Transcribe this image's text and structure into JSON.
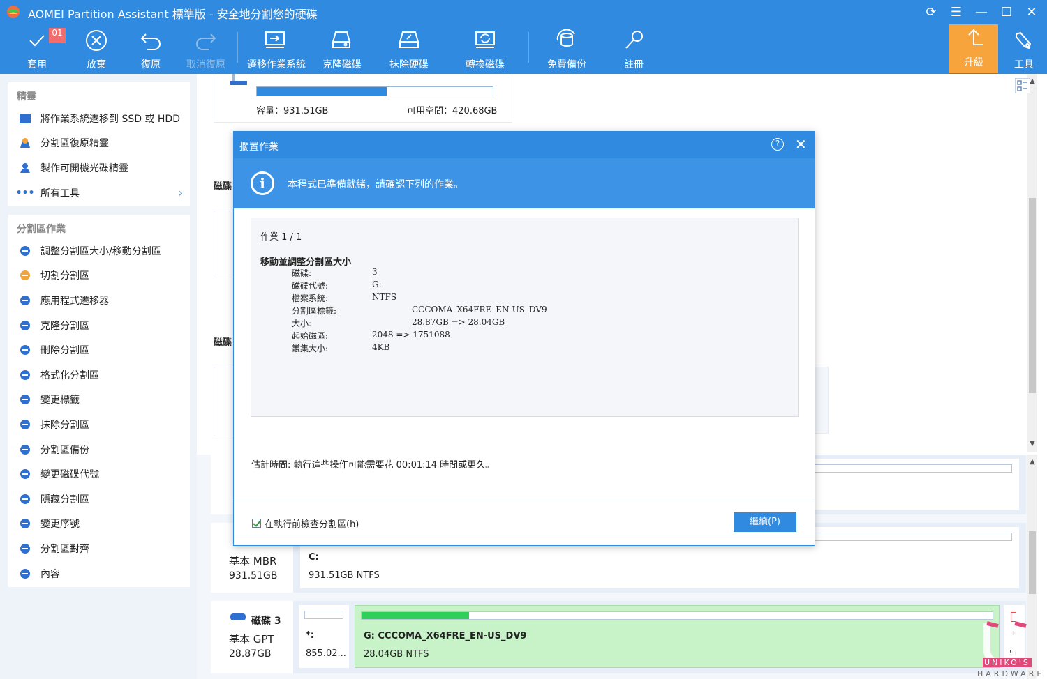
{
  "window": {
    "title": "AOMEI Partition Assistant 標準版 - 安全地分割您的硬碟"
  },
  "toolbar": {
    "apply": "套用",
    "apply_badge": "01",
    "discard": "放棄",
    "undo": "復原",
    "redo": "取消復原",
    "migrate_os": "遷移作業系統",
    "clone_disk": "克隆磁碟",
    "wipe_disk": "抹除硬碟",
    "convert_disk": "轉換磁碟",
    "free_backup": "免費備份",
    "register": "註冊",
    "upgrade": "升級",
    "tools": "工具"
  },
  "sidebar": {
    "wizards_title": "精靈",
    "wizards": [
      {
        "label": "將作業系統遷移到 SSD 或 HDD",
        "icon": "migrate-os-icon"
      },
      {
        "label": "分割區復原精靈",
        "icon": "partition-recovery-icon"
      },
      {
        "label": "製作可開機光碟精靈",
        "icon": "bootable-media-icon"
      },
      {
        "label": "所有工具",
        "icon": "more-icon"
      }
    ],
    "ops_title": "分割區作業",
    "ops": [
      {
        "label": "調整分割區大小/移動分割區",
        "icon": "resize-icon"
      },
      {
        "label": "切割分割區",
        "icon": "split-icon"
      },
      {
        "label": "應用程式遷移器",
        "icon": "app-mover-icon"
      },
      {
        "label": "克隆分割區",
        "icon": "clone-partition-icon"
      },
      {
        "label": "刪除分割區",
        "icon": "delete-icon"
      },
      {
        "label": "格式化分割區",
        "icon": "format-icon"
      },
      {
        "label": "變更標籤",
        "icon": "label-icon"
      },
      {
        "label": "抹除分割區",
        "icon": "wipe-icon"
      },
      {
        "label": "分割區備份",
        "icon": "backup-icon"
      },
      {
        "label": "變更磁碟代號",
        "icon": "drive-letter-icon"
      },
      {
        "label": "隱藏分割區",
        "icon": "hide-icon"
      },
      {
        "label": "變更序號",
        "icon": "serial-icon"
      },
      {
        "label": "分割區對齊",
        "icon": "align-icon"
      },
      {
        "label": "內容",
        "icon": "info-icon"
      }
    ]
  },
  "top_disk": {
    "capacity": "容量：931.51GB",
    "free": "可用空間：420.68GB",
    "used_fraction": 0.55
  },
  "partial_labels": {
    "disk_label_a": "磁碟",
    "disk_label_b": "磁碟"
  },
  "disks": [
    {
      "type": "基本 MBR",
      "size": "931.51GB",
      "partition_label": "C:",
      "partition_meta": "931.51GB NTFS"
    },
    {
      "name": "磁碟 3",
      "type": "基本 GPT",
      "size": "28.87GB",
      "small_partition_label": "*:",
      "small_partition_meta": "855.02...",
      "partition_label": "G: CCCOMA_X64FRE_EN-US_DV9",
      "partition_meta": "28.04GB NTFS",
      "used_fraction": 0.17,
      "tail_label": "*",
      "tail_meta": "5("
    }
  ],
  "dialog": {
    "title": "擱置作業",
    "banner": "本程式已準備就緒，請確認下列的作業。",
    "op_count": "作業 1 / 1",
    "op_heading": "移動並調整分割區大小",
    "rows": [
      {
        "key": "磁碟:",
        "value": "3"
      },
      {
        "key": "磁碟代號:",
        "value": "G:"
      },
      {
        "key": "檔案系統:",
        "value": "NTFS"
      },
      {
        "key": "分割區標籤:",
        "value": "CCCOMA_X64FRE_EN-US_DV9"
      },
      {
        "key": "大小:",
        "value": "28.87GB => 28.04GB"
      },
      {
        "key": "起始磁區:",
        "value": "2048 => 1751088"
      },
      {
        "key": "叢集大小:",
        "value": "4KB"
      }
    ],
    "estimate": "估計時間: 執行這些操作可能需要花 00:01:14 時間或更久。",
    "check_label": "在執行前檢查分割區(h)",
    "continue_label": "繼續(P)"
  },
  "watermark": {
    "line1": "UNIKO'S",
    "line2": "HARDWARE"
  }
}
